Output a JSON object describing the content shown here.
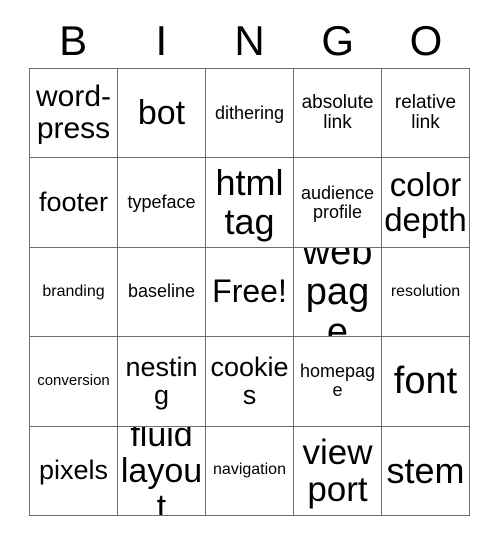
{
  "card": {
    "title": "BINGO",
    "header_letters": [
      "B",
      "I",
      "N",
      "G",
      "O"
    ],
    "free_space_label": "Free!",
    "grid_columns": 5,
    "grid_rows": 5,
    "colors": {
      "background": "#ffffff",
      "text": "#000000",
      "grid_line": "#6e6e6e"
    },
    "cells": [
      [
        {
          "text": "word-press",
          "size": "2xl"
        },
        {
          "text": "bot",
          "size": "5xl"
        },
        {
          "text": "dithering",
          "size": "md"
        },
        {
          "text": "absolute link",
          "size": "lg"
        },
        {
          "text": "relative link",
          "size": "lg"
        }
      ],
      [
        {
          "text": "footer",
          "size": "xl"
        },
        {
          "text": "typeface",
          "size": "md"
        },
        {
          "text": "html tag",
          "size": "7xl"
        },
        {
          "text": "audience profile",
          "size": "md"
        },
        {
          "text": "color depth",
          "size": "4xl"
        }
      ],
      [
        {
          "text": "branding",
          "size": "sm"
        },
        {
          "text": "baseline",
          "size": "md"
        },
        {
          "text": "Free!",
          "size": "3xl"
        },
        {
          "text": "web page",
          "size": "8xl"
        },
        {
          "text": "resolution",
          "size": "sm"
        }
      ],
      [
        {
          "text": "conversion",
          "size": "xs"
        },
        {
          "text": "nesting",
          "size": "xl"
        },
        {
          "text": "cookies",
          "size": "xl"
        },
        {
          "text": "homepage",
          "size": "md"
        },
        {
          "text": "font",
          "size": "8xl"
        }
      ],
      [
        {
          "text": "pixels",
          "size": "xl"
        },
        {
          "text": "fluid layout",
          "size": "5xl"
        },
        {
          "text": "navigation",
          "size": "sm"
        },
        {
          "text": "view port",
          "size": "6xl"
        },
        {
          "text": "stem",
          "size": "7xl"
        }
      ]
    ]
  }
}
